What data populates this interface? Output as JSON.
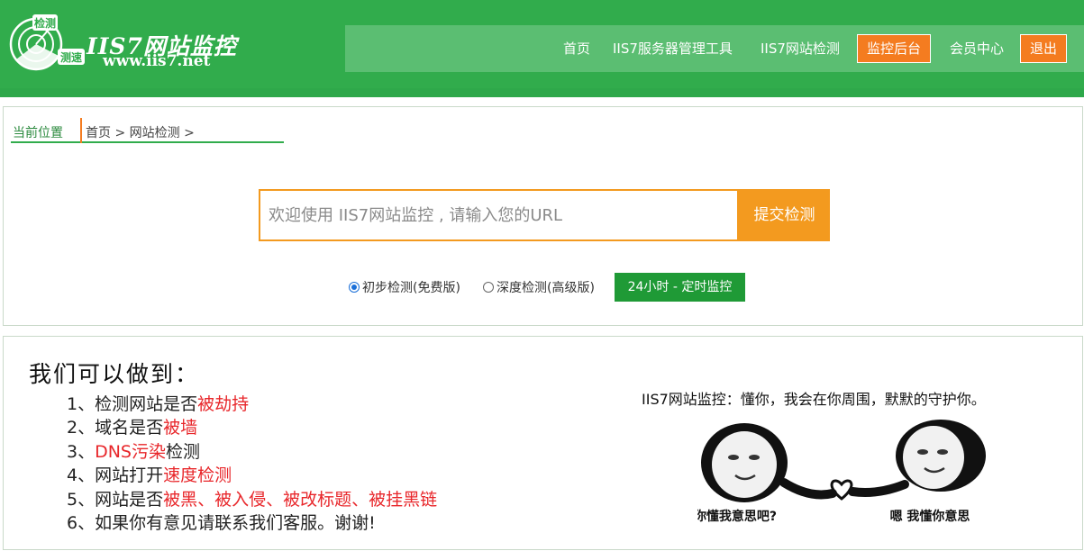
{
  "header": {
    "logo_badge_top": "检测",
    "logo_badge_bottom": "测速",
    "title": "IIS7网站监控",
    "url": "www.iis7.net"
  },
  "nav": {
    "items": [
      "首页",
      "IIS7服务器管理工具",
      "IIS7网站检测"
    ],
    "monitor_backend": "监控后台",
    "member_center": "会员中心",
    "logout": "退出"
  },
  "breadcrumb": {
    "label": "当前位置",
    "home": "首页",
    "sep1": ">",
    "current": "网站检测",
    "sep2": ">"
  },
  "search": {
    "placeholder": "欢迎使用 IIS7网站监控 , 请输入您的URL",
    "submit": "提交检测"
  },
  "options": {
    "basic": "初步检测(免费版)",
    "deep": "深度检测(高级版)",
    "selected": "basic",
    "monitor": "24小时 - 定时监控"
  },
  "features": {
    "title": "我们可以做到：",
    "items": [
      {
        "prefix": "1、检测网站是否",
        "highlight": "被劫持",
        "suffix": ""
      },
      {
        "prefix": "2、域名是否",
        "highlight": "被墙",
        "suffix": ""
      },
      {
        "prefix": "3、",
        "highlight": "DNS污染",
        "suffix": "检测"
      },
      {
        "prefix": "4、网站打开",
        "highlight": "速度检测",
        "suffix": ""
      },
      {
        "prefix": "5、网站是否",
        "highlight": "被黑、被入侵、被改标题、被挂黑链",
        "suffix": ""
      },
      {
        "prefix": "6、如果你有意见请联系我们客服。谢谢!",
        "highlight": "",
        "suffix": ""
      }
    ]
  },
  "quote": "IIS7网站监控：懂你，我会在你周围，默默的守护你。",
  "meme": {
    "left_caption": "你懂我意思吧?",
    "right_caption": "嗯 我懂你意思"
  },
  "colors": {
    "brand_green": "#31ac4c",
    "accent_orange": "#f39a1f",
    "highlight_red": "#e8262a"
  }
}
